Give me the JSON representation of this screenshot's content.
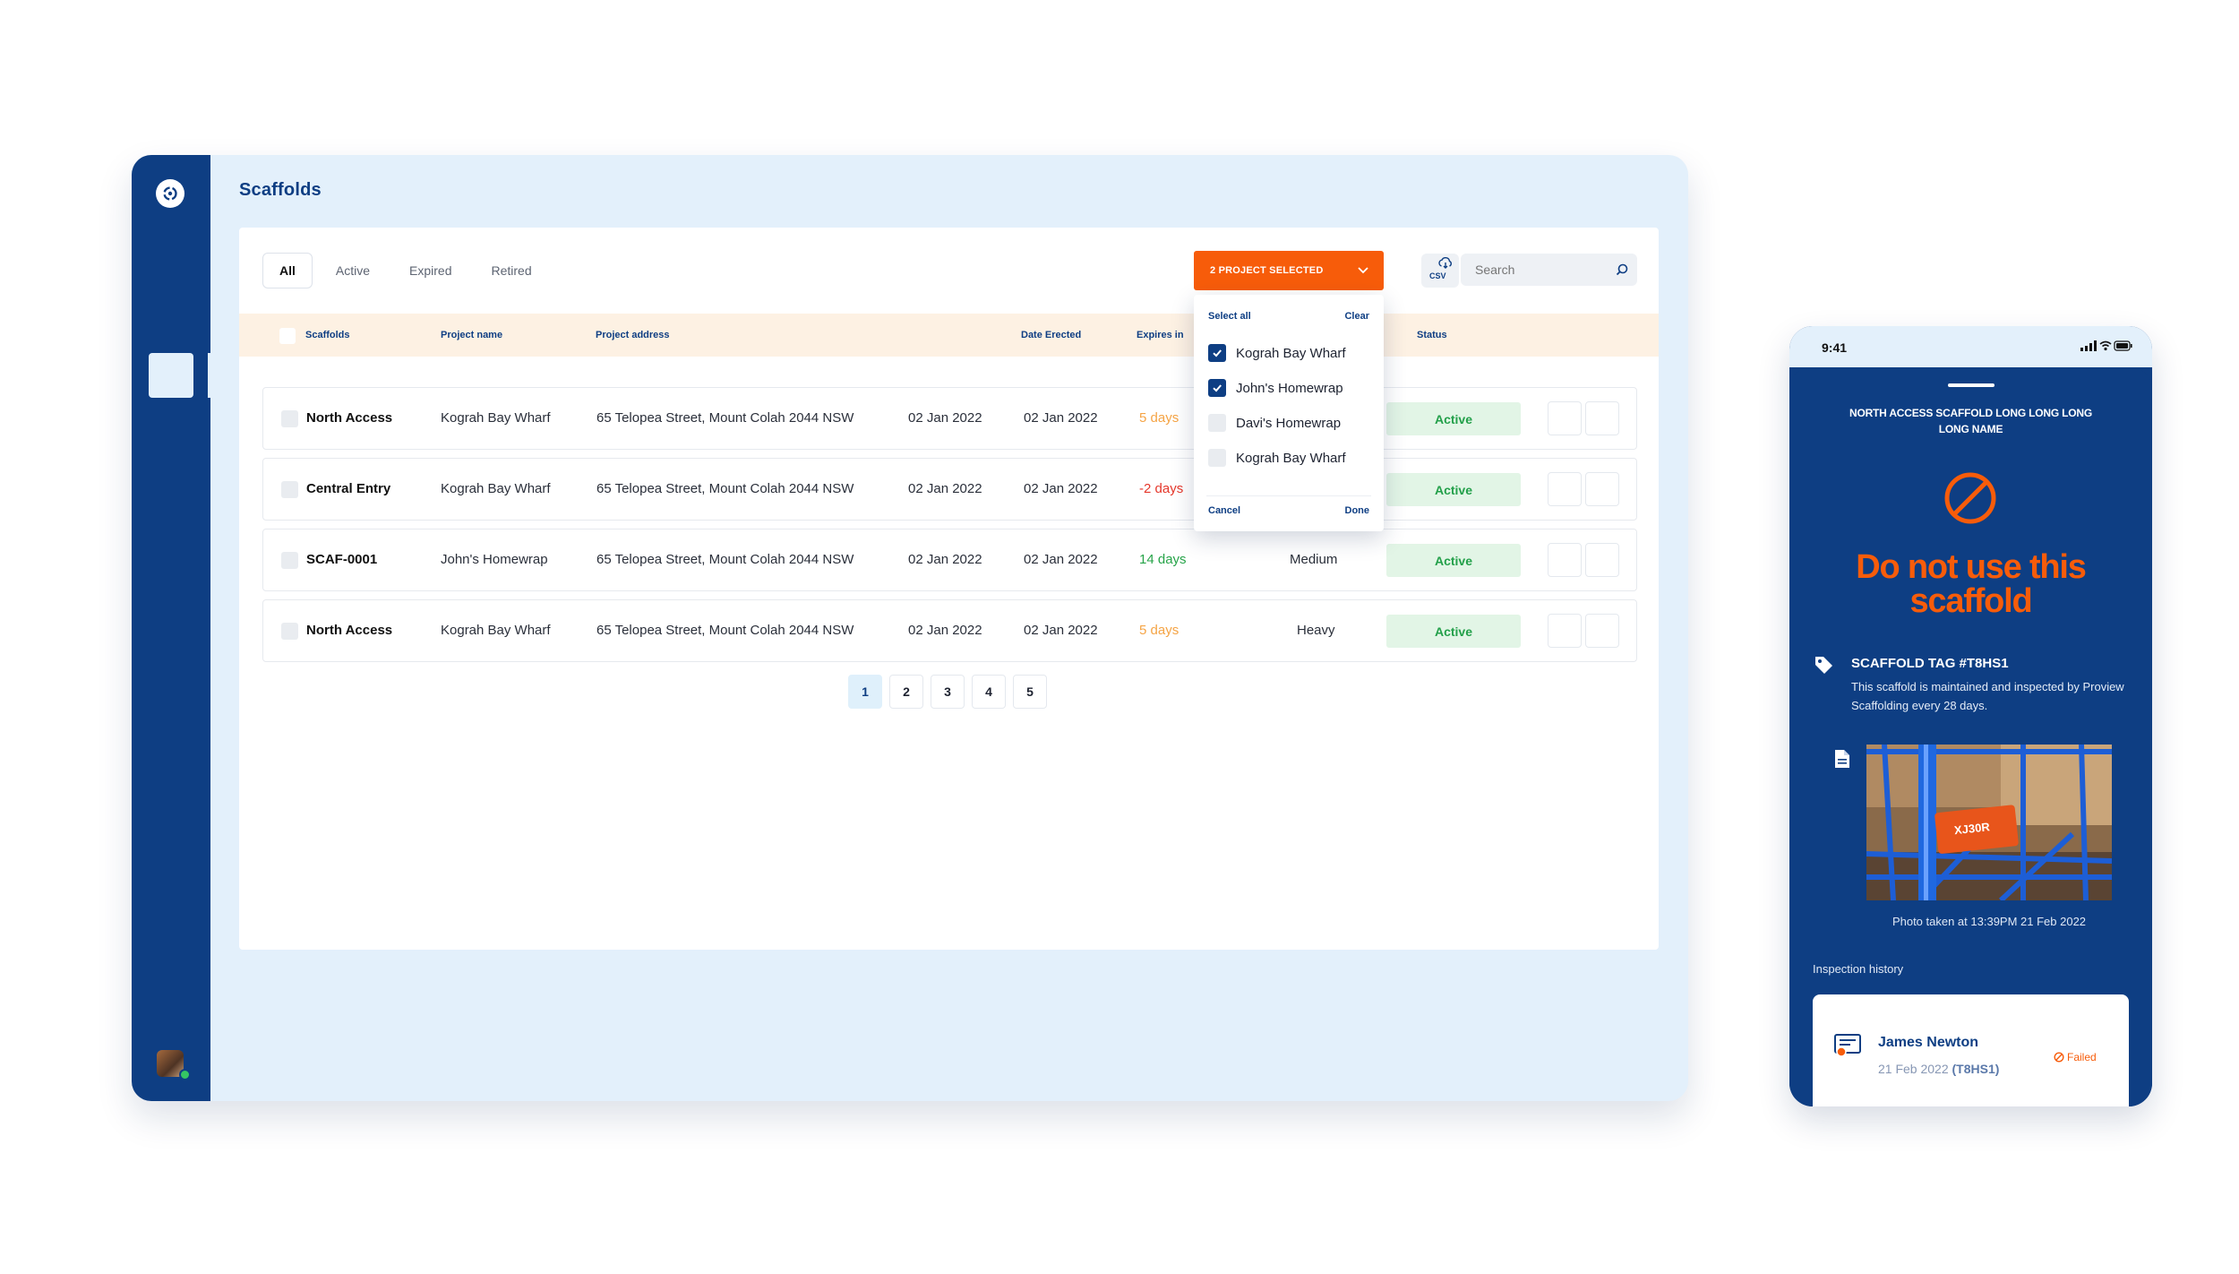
{
  "app": {
    "page_title": "Scaffolds",
    "tabs": [
      {
        "label": "All",
        "active": true
      },
      {
        "label": "Active",
        "active": false
      },
      {
        "label": "Expired",
        "active": false
      },
      {
        "label": "Retired",
        "active": false
      }
    ],
    "project_filter": {
      "label": "2 PROJECT SELECTED",
      "select_all": "Select all",
      "clear": "Clear",
      "options": [
        {
          "label": "Kograh Bay Wharf",
          "checked": true
        },
        {
          "label": "John's Homewrap",
          "checked": true
        },
        {
          "label": "Davi's Homewrap",
          "checked": false
        },
        {
          "label": "Kograh Bay Wharf",
          "checked": false
        }
      ],
      "cancel": "Cancel",
      "done": "Done"
    },
    "csv_label": "CSV",
    "search_placeholder": "Search",
    "columns": {
      "scaffolds": "Scaffolds",
      "project_name": "Project name",
      "project_address": "Project address",
      "date_erected": "Date Erected",
      "expires_in": "Expires in",
      "status": "Status"
    },
    "rows": [
      {
        "name": "North Access",
        "project": "Kograh Bay Wharf",
        "address": "65 Telopea Street, Mount Colah 2044 NSW",
        "date_erected": "02 Jan 2022",
        "date2": "02 Jan 2022",
        "expires": "5 days",
        "expires_tone": "orange",
        "duty": "",
        "status": "Active"
      },
      {
        "name": "Central Entry",
        "project": "Kograh Bay Wharf",
        "address": "65 Telopea Street, Mount Colah 2044 NSW",
        "date_erected": "02 Jan 2022",
        "date2": "02 Jan 2022",
        "expires": "-2 days",
        "expires_tone": "red",
        "duty": "",
        "status": "Active"
      },
      {
        "name": "SCAF-0001",
        "project": "John's Homewrap",
        "address": "65 Telopea Street, Mount Colah 2044 NSW",
        "date_erected": "02 Jan 2022",
        "date2": "02 Jan 2022",
        "expires": "14 days",
        "expires_tone": "green",
        "duty": "Medium",
        "status": "Active"
      },
      {
        "name": "North Access",
        "project": "Kograh Bay Wharf",
        "address": "65 Telopea Street, Mount Colah 2044 NSW",
        "date_erected": "02 Jan 2022",
        "date2": "02 Jan 2022",
        "expires": "5 days",
        "expires_tone": "orange",
        "duty": "Heavy",
        "status": "Active"
      }
    ],
    "pagination": {
      "pages": [
        "1",
        "2",
        "3",
        "4",
        "5"
      ],
      "current": "1"
    }
  },
  "phone": {
    "time": "9:41",
    "title": "NORTH ACCESS SCAFFOLD LONG LONG LONG LONG NAME",
    "warning": "Do not use this scaffold",
    "tag_title": "SCAFFOLD TAG #T8HS1",
    "tag_text": "This scaffold is maintained and inspected by Proview Scaffolding every 28 days.",
    "photo_label": "XJ30R",
    "photo_caption": "Photo taken at 13:39PM 21 Feb 2022",
    "history_label": "Inspection history",
    "history": {
      "name": "James Newton",
      "date": "21 Feb 2022",
      "tag": "(T8HS1)",
      "result": "Failed"
    }
  },
  "colors": {
    "brand_navy": "#0e3e83",
    "accent_orange": "#f75c0a",
    "active_green": "#23a04a",
    "header_cream": "#fdf1e3",
    "app_bg": "#e3f0fb"
  },
  "icons": [
    "logo-icon",
    "chevron-down-icon",
    "cloud-download-icon",
    "search-icon",
    "check-icon",
    "no-entry-icon",
    "tag-icon",
    "document-icon",
    "certificate-icon",
    "failed-icon",
    "signal-icon",
    "wifi-icon",
    "battery-icon"
  ]
}
